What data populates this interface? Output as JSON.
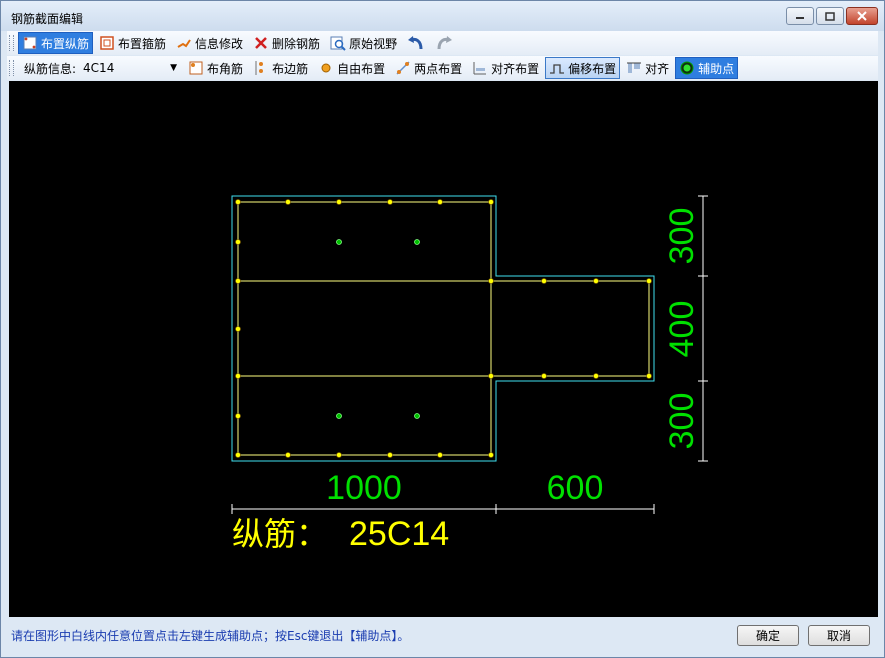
{
  "window": {
    "title": "钢筋截面编辑"
  },
  "toolbar1": [
    {
      "label": "布置纵筋",
      "icon": "rebar-icon",
      "state": "selected"
    },
    {
      "label": "布置箍筋",
      "icon": "stirrup-icon",
      "state": "normal"
    },
    {
      "label": "信息修改",
      "icon": "edit-info-icon",
      "state": "normal"
    },
    {
      "label": "删除钢筋",
      "icon": "delete-x-icon",
      "state": "normal"
    },
    {
      "label": "原始视野",
      "icon": "zoom-reset-icon",
      "state": "normal"
    }
  ],
  "toolbar2": {
    "info_label": "纵筋信息:",
    "info_value": "4C14",
    "buttons": [
      {
        "label": "布角筋",
        "icon": "corner-rebar-icon",
        "state": "normal"
      },
      {
        "label": "布边筋",
        "icon": "edge-rebar-icon",
        "state": "normal"
      },
      {
        "label": "自由布置",
        "icon": "free-place-icon",
        "state": "normal"
      },
      {
        "label": "两点布置",
        "icon": "two-point-icon",
        "state": "normal"
      },
      {
        "label": "对齐布置",
        "icon": "align-place-icon",
        "state": "normal"
      },
      {
        "label": "偏移布置",
        "icon": "offset-place-icon",
        "state": "active"
      },
      {
        "label": "对齐",
        "icon": "align-icon",
        "state": "normal"
      },
      {
        "label": "辅助点",
        "icon": "aux-point-icon",
        "state": "selected"
      }
    ]
  },
  "drawing": {
    "dims_bottom": [
      "1000",
      "600"
    ],
    "dims_right": [
      "300",
      "400",
      "300"
    ],
    "rebar_label": "纵筋：",
    "rebar_spec": "25C14",
    "colors": {
      "outline": "#40e0f0",
      "inner": "#ffff80",
      "dimension": "#00e000",
      "text": "#ffff00",
      "aux": "#00ff00"
    }
  },
  "status": {
    "message": "请在图形中白线内任意位置点击左键生成辅助点；按Esc键退出【辅助点】。",
    "ok": "确定",
    "cancel": "取消"
  }
}
